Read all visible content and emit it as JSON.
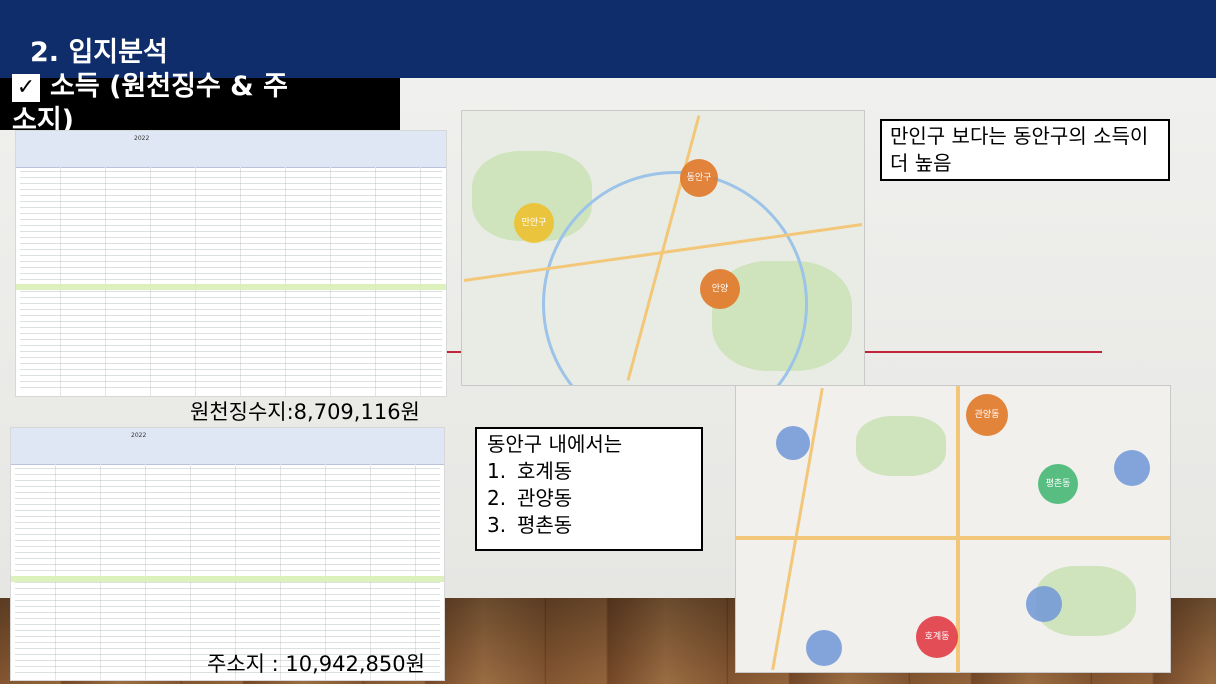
{
  "header": {
    "title": "2. 입지분석",
    "subtitle": "소득 (원천징수 & 주소지)",
    "check_glyph": "✓"
  },
  "tables": {
    "withholding": {
      "year_label": "2022",
      "caption": "원천징수지:8,709,116원"
    },
    "address": {
      "year_label": "2022",
      "caption": "주소지 : 10,942,850원"
    }
  },
  "map1": {
    "bubbles": [
      {
        "label": "만안구"
      },
      {
        "label": "동안구"
      },
      {
        "label": "안양"
      }
    ]
  },
  "map2": {
    "bubbles": [
      {
        "label": "관양동"
      },
      {
        "label": "평촌동"
      },
      {
        "label": "호계동"
      }
    ]
  },
  "notes": {
    "note1": "만인구 보다는 동안구의 소득이 더 높음",
    "note2_title": "동안구 내에서는",
    "note2_items": [
      {
        "num": "1.",
        "text": "호계동"
      },
      {
        "num": "2.",
        "text": "관양동"
      },
      {
        "num": "3.",
        "text": "평촌동"
      }
    ]
  },
  "colors": {
    "header_bg": "#0f2d6b",
    "accent_line": "#c0243a",
    "table_highlight": "#d9f0b5"
  }
}
